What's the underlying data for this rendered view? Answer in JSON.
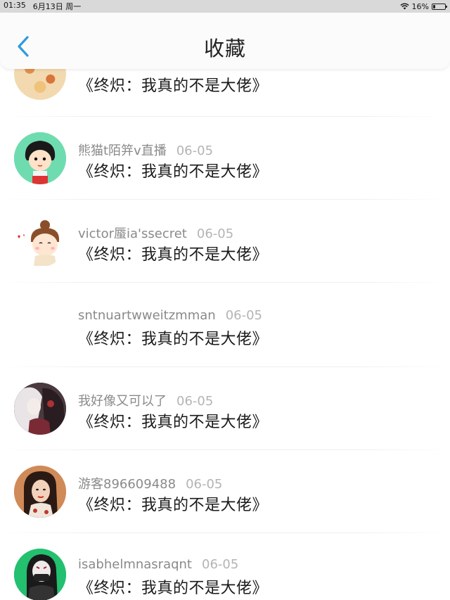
{
  "status_bar": {
    "time": "01:35",
    "date": "6月13日 周一",
    "battery": "16%"
  },
  "nav": {
    "title": "收藏",
    "back_icon": "chevron-left-icon",
    "accent": "#2d9cdb"
  },
  "favorites": [
    {
      "user": "",
      "date": "",
      "title": "《终炽：我真的不是大佬》",
      "avatar": "floral-pattern-avatar"
    },
    {
      "user": "熊猫t陌笄v直播",
      "date": "06-05",
      "title": "《终炽：我真的不是大佬》",
      "avatar": "cartoon-girl-avatar"
    },
    {
      "user": "victor蜃ia'ssecret",
      "date": "06-05",
      "title": "《终炽：我真的不是大佬》",
      "avatar": "cartoon-bun-girl-avatar"
    },
    {
      "user": "sntnuartwweitzmman",
      "date": "06-05",
      "title": "《终炽：我真的不是大佬》",
      "avatar": ""
    },
    {
      "user": "我好像又可以了",
      "date": "06-05",
      "title": "《终炽：我真的不是大佬》",
      "avatar": "anime-dark-avatar"
    },
    {
      "user": "游客896609488",
      "date": "06-05",
      "title": "《终炽：我真的不是大佬》",
      "avatar": "woman-photo-avatar"
    },
    {
      "user": "isabhelmnasraqnt",
      "date": "06-05",
      "title": "《终炽：我真的不是大佬》",
      "avatar": "masked-figure-avatar"
    }
  ]
}
